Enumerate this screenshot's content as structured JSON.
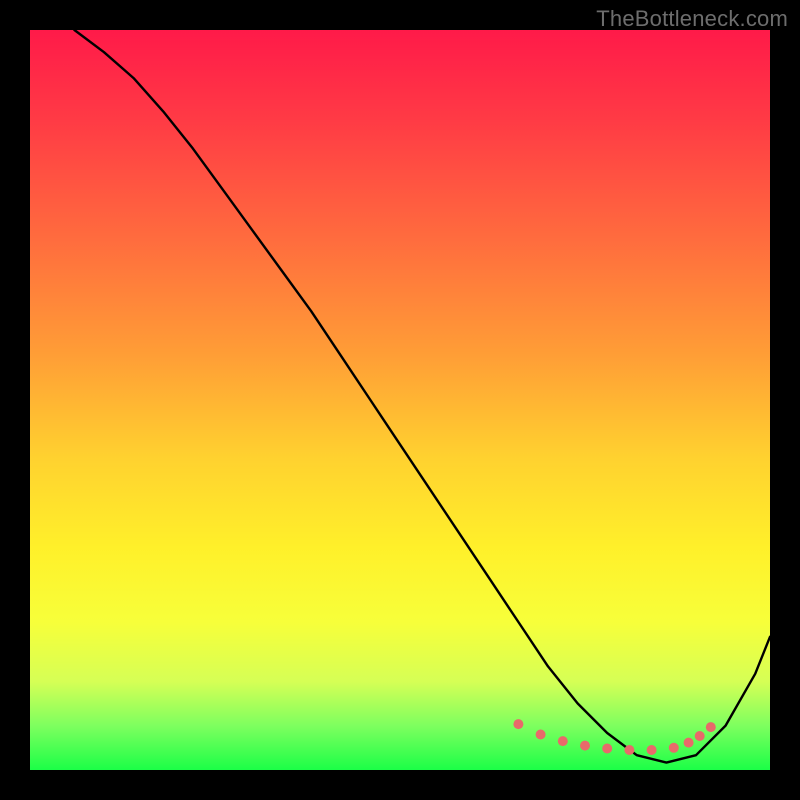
{
  "watermark": "TheBottleneck.com",
  "chart_data": {
    "type": "line",
    "title": "",
    "xlabel": "",
    "ylabel": "",
    "xlim": [
      0,
      100
    ],
    "ylim": [
      0,
      100
    ],
    "series": [
      {
        "name": "bottleneck-curve",
        "color": "#000000",
        "x": [
          6,
          10,
          14,
          18,
          22,
          26,
          30,
          34,
          38,
          42,
          46,
          50,
          54,
          58,
          62,
          66,
          70,
          74,
          78,
          82,
          86,
          90,
          94,
          98,
          100
        ],
        "y": [
          100,
          97,
          93.5,
          89,
          84,
          78.5,
          73,
          67.5,
          62,
          56,
          50,
          44,
          38,
          32,
          26,
          20,
          14,
          9,
          5,
          2,
          1,
          2,
          6,
          13,
          18
        ]
      }
    ],
    "markers": {
      "name": "highlight-points",
      "color": "#e86a6a",
      "x": [
        66,
        69,
        72,
        75,
        78,
        81,
        84,
        87,
        89,
        90.5,
        92
      ],
      "y": [
        6.2,
        4.8,
        3.9,
        3.3,
        2.9,
        2.7,
        2.7,
        3.0,
        3.7,
        4.6,
        5.8
      ]
    },
    "colors": {
      "gradient_top": "#ff1a49",
      "gradient_mid": "#fff02a",
      "gradient_bottom": "#1bff47",
      "curve": "#000000",
      "marker": "#e86a6a",
      "frame": "#000000",
      "watermark_text": "#6d6d6d"
    }
  }
}
